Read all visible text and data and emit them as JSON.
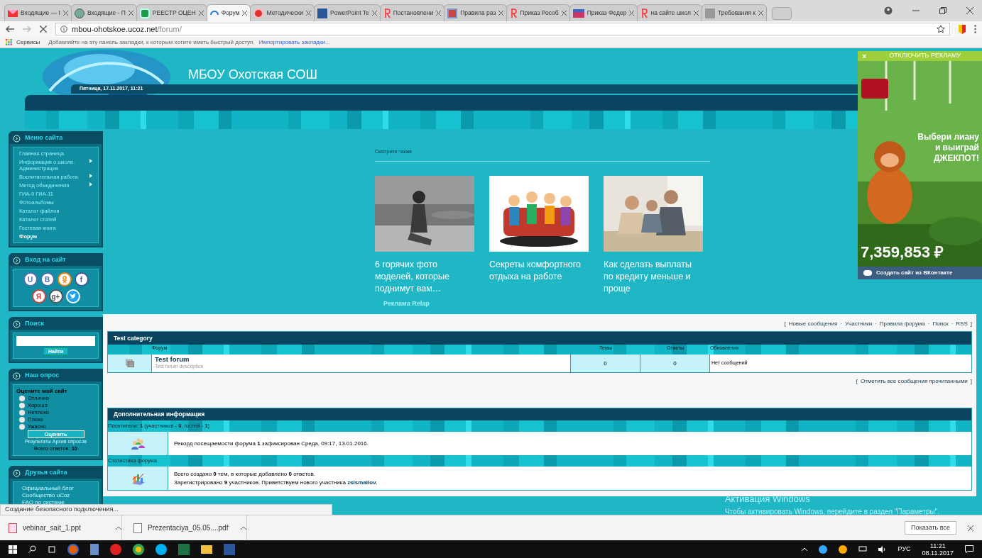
{
  "browser": {
    "tabs": [
      {
        "label": "Входящие — I",
        "kind": "mail",
        "selected": false
      },
      {
        "label": "Входящие - П",
        "kind": "globe",
        "selected": false
      },
      {
        "label": "РЕЕСТР ОЦЕН",
        "kind": "sheet",
        "selected": false
      },
      {
        "label": "Форум",
        "kind": "loading",
        "selected": true
      },
      {
        "label": "Методически",
        "kind": "red",
        "selected": false
      },
      {
        "label": "PowerPoint Te",
        "kind": "ppt",
        "selected": false
      },
      {
        "label": "Постановлени",
        "kind": "yandex",
        "selected": false
      },
      {
        "label": "Правила раз",
        "kind": "rg",
        "selected": false
      },
      {
        "label": "Приказ Рособ",
        "kind": "yandex",
        "selected": false
      },
      {
        "label": "Приказ Федер",
        "kind": "mail2",
        "selected": false
      },
      {
        "label": "на сайте школ",
        "kind": "yandex",
        "selected": false
      },
      {
        "label": "Требования к",
        "kind": "grey",
        "selected": false
      }
    ],
    "address": {
      "host": "mbou-ohotskoe.ucoz.net",
      "path": "/forum/"
    },
    "bookmarks": {
      "apps": "Сервисы",
      "hint": "Добавляйте на эту панель закладки, к которым хотите иметь быстрый доступ.",
      "import_link": "Импортировать закладки..."
    }
  },
  "site": {
    "title": "МБОУ Охотская СОШ",
    "date": "Пятница, 17.11.2017, 11:21",
    "menu": {
      "title": "Меню сайта",
      "items": [
        {
          "label": "Главная страница",
          "submenu": false,
          "selected": false
        },
        {
          "label": "Информация о школе. Администрация",
          "submenu": true,
          "selected": false
        },
        {
          "label": "Воспитательная работа",
          "submenu": true,
          "selected": false
        },
        {
          "label": "Метод объединения",
          "submenu": true,
          "selected": false
        },
        {
          "label": "ГИА-9 ГИА-11",
          "submenu": false,
          "selected": false
        },
        {
          "label": "Фотоальбомы",
          "submenu": false,
          "selected": false
        },
        {
          "label": "Каталог файлов",
          "submenu": false,
          "selected": false
        },
        {
          "label": "Каталог статей",
          "submenu": false,
          "selected": false
        },
        {
          "label": "Гостевая книга",
          "submenu": false,
          "selected": false
        },
        {
          "label": "Форум",
          "submenu": false,
          "selected": true
        }
      ]
    },
    "login": {
      "title": "Вход на сайт",
      "socials": [
        {
          "kind": "letter",
          "text": "U",
          "color": "#5a6fb0"
        },
        {
          "kind": "letter",
          "text": "B",
          "color": "#4a6ea8"
        },
        {
          "kind": "ok",
          "color": "#ee8208"
        },
        {
          "kind": "letter",
          "text": "f",
          "color": "#3b5998"
        },
        {
          "kind": "letter",
          "text": "Я",
          "color": "#d0443e"
        },
        {
          "kind": "letter",
          "text": "g+",
          "color": "#555555"
        },
        {
          "kind": "twitter",
          "color": "#1da1f2"
        }
      ]
    },
    "search": {
      "title": "Поиск",
      "button": "Найти"
    },
    "poll": {
      "title": "Наш опрос",
      "question": "Оцените мой сайт",
      "options": [
        {
          "label": "Отлично",
          "selected": false
        },
        {
          "label": "Хорошо",
          "selected": false
        },
        {
          "label": "Неплохо",
          "selected": false
        },
        {
          "label": "Плохо",
          "selected": false
        },
        {
          "label": "Ужасно",
          "selected": false
        }
      ],
      "button": "Оценить",
      "results_link": "Результаты",
      "archive_link": "Архив опросов",
      "total_label": "Всего ответов:",
      "total": "10"
    },
    "friends": {
      "title": "Друзья сайта",
      "items": [
        "Официальный блог",
        "Сообщество uCoz",
        "FAQ по системе"
      ]
    },
    "related": {
      "title": "Смотрите также",
      "cards": [
        {
          "caption": "6 горячих фото моделей, которые поднимут вам…",
          "kind": "picture"
        },
        {
          "caption": "Секреты комфортного отдыха на работе",
          "kind": "picture"
        },
        {
          "caption": "Как сделать выплаты по кредиту меньше и проще",
          "kind": "picture"
        }
      ],
      "ad_label": "Реклама Relap"
    },
    "forum": {
      "bracket_open": "[",
      "bracket_close": "]",
      "separator": "·",
      "top_links": [
        "Новые сообщения",
        "Участники",
        "Правила форума",
        "Поиск",
        "RSS"
      ],
      "category": "Test category",
      "columns": [
        "Форум",
        "Темы",
        "Ответы",
        "Обновления"
      ],
      "rows": [
        {
          "title": "Test forum",
          "description": "Test forum description",
          "topics": "0",
          "replies": "0",
          "updates": "Нет сообщений"
        }
      ],
      "mark_read": "Отметить все сообщения прочитанными",
      "info": {
        "title": "Дополнительная информация",
        "visitors": "Посетители: **1**  (участников - **0**, гостей - **1**)",
        "record": "Рекорд посещаемости форума **1** зафиксирован Среда, 09:17, 13.01.2016.",
        "stats_title": "Статистика форума",
        "stats_line1": "Всего создано **0** тем, в которые добавлено **0** ответов.",
        "stats_line2": "Зарегистрировано **9** участников. Приветствуем нового участника ",
        "new_member": "zsismailov",
        "stats_end": "."
      }
    }
  },
  "ad": {
    "close": "×",
    "disable": "ОТКЛЮЧИТЬ РЕКЛАМУ",
    "slogan": "Выбери лиану и выиграй ДЖЕКПОТ!",
    "jackpot": "7,359,853 ₽",
    "footer": "Создать сайт из ВКонтакте"
  },
  "status": "Создание безопасного подключения...",
  "activation": {
    "title": "Активация Windows",
    "text": "Чтобы активировать Windows, перейдите в раздел \"Параметры\"."
  },
  "downloads": {
    "files": [
      {
        "name": "vebinar_sait_1.ppt",
        "kind": "ppt"
      },
      {
        "name": "Prezentaciya_05.05....pdf",
        "kind": "pdf"
      }
    ],
    "show_all": "Показать все"
  },
  "taskbar": {
    "lang": "РУС",
    "time": "11:21",
    "date": "08.11.2017"
  }
}
